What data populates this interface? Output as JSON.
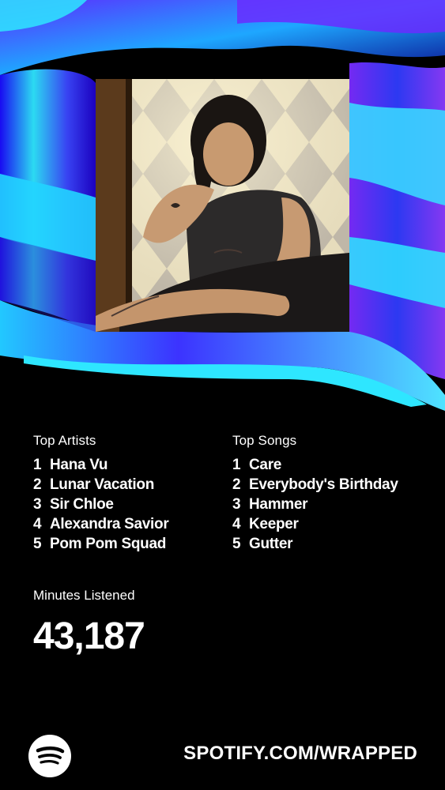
{
  "colors": {
    "background": "#000000",
    "text": "#ffffff",
    "accent_cyan": "#2ee6ff",
    "accent_blue": "#2f3cff",
    "accent_violet": "#7a2cff"
  },
  "artwork": {
    "subject": "artist-portrait-photo"
  },
  "top_artists": {
    "title": "Top Artists",
    "items": [
      {
        "rank": "1",
        "name": "Hana Vu"
      },
      {
        "rank": "2",
        "name": "Lunar Vacation"
      },
      {
        "rank": "3",
        "name": "Sir Chloe"
      },
      {
        "rank": "4",
        "name": "Alexandra Savior"
      },
      {
        "rank": "5",
        "name": "Pom Pom Squad"
      }
    ]
  },
  "top_songs": {
    "title": "Top Songs",
    "items": [
      {
        "rank": "1",
        "name": "Care"
      },
      {
        "rank": "2",
        "name": "Everybody's Birthday"
      },
      {
        "rank": "3",
        "name": "Hammer"
      },
      {
        "rank": "4",
        "name": "Keeper"
      },
      {
        "rank": "5",
        "name": "Gutter"
      }
    ]
  },
  "minutes": {
    "label": "Minutes Listened",
    "value": "43,187"
  },
  "footer": {
    "icon": "spotify-logo-icon",
    "url": "SPOTIFY.COM/WRAPPED"
  }
}
